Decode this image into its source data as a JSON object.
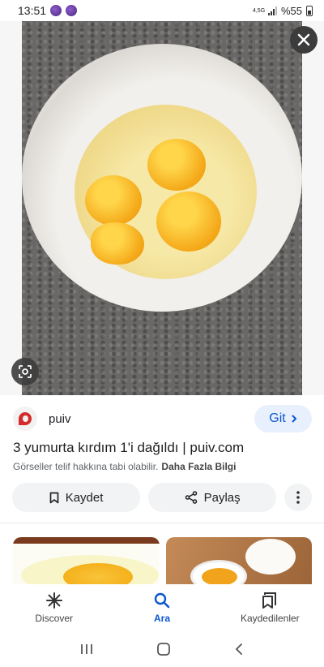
{
  "status_bar": {
    "time": "13:51",
    "network": "4,5G",
    "battery": "%55"
  },
  "viewer": {
    "close_icon": "close-icon",
    "lens_icon": "google-lens-icon"
  },
  "source": {
    "site_name": "puiv",
    "visit_label": "Git",
    "title": "3 yumurta kırdım 1'i dağıldı | puiv.com",
    "copyright_notice": "Görseller telif hakkına tabi olabilir.",
    "more_info_link": "Daha Fazla Bilgi"
  },
  "actions": {
    "save_label": "Kaydet",
    "share_label": "Paylaş"
  },
  "bottom_nav": {
    "items": [
      {
        "label": "Discover",
        "icon": "asterisk-icon",
        "active": false
      },
      {
        "label": "Ara",
        "icon": "search-icon",
        "active": true
      },
      {
        "label": "Kaydedilenler",
        "icon": "bookmarks-icon",
        "active": false
      }
    ]
  },
  "colors": {
    "accent": "#0b57d0",
    "chip_bg": "#e8f0fe",
    "pill_bg": "#f1f3f4",
    "site_logo": "#d42b2b"
  }
}
